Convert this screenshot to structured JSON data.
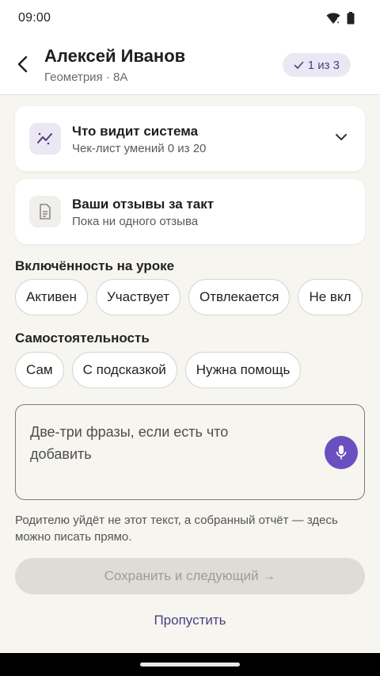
{
  "status_bar": {
    "time": "09:00"
  },
  "header": {
    "name": "Алексей Иванов",
    "subtitle": "Геометрия · 8А",
    "progress": "1 из 3"
  },
  "cards": {
    "system": {
      "title": "Что видит система",
      "subtitle": "Чек-лист умений 0 из 20"
    },
    "reviews": {
      "title": "Ваши отзывы за такт",
      "subtitle": "Пока ни одного отзыва"
    }
  },
  "engagement": {
    "title": "Включённость на уроке",
    "chips": [
      "Активен",
      "Участвует",
      "Отвлекается",
      "Не вкл"
    ]
  },
  "independence": {
    "title": "Самостоятельность",
    "chips": [
      "Сам",
      "С подсказкой",
      "Нужна помощь"
    ]
  },
  "note": {
    "placeholder": "Две-три фразы, если есть что добавить"
  },
  "hint": "Родителю уйдёт не этот текст, а собранный отчёт — здесь можно писать прямо.",
  "actions": {
    "save": "Сохранить и следующий →",
    "skip": "Пропустить"
  },
  "colors": {
    "accent": "#6a4fc0",
    "badge_bg": "#ebe8f4",
    "background": "#f6f5f0"
  }
}
